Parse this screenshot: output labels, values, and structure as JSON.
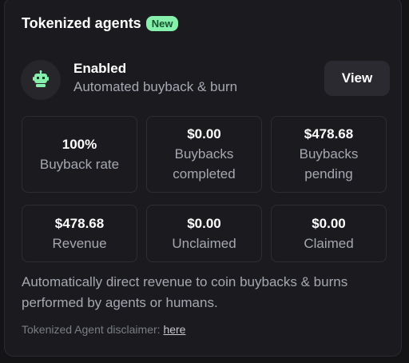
{
  "header": {
    "title": "Tokenized agents",
    "badge": "New"
  },
  "agent": {
    "icon": "robot-icon",
    "icon_color": "#86efac",
    "status": "Enabled",
    "description": "Automated buyback & burn",
    "view_label": "View"
  },
  "stats": [
    {
      "value": "100%",
      "label": "Buyback rate"
    },
    {
      "value": "$0.00",
      "label": "Buybacks completed"
    },
    {
      "value": "$478.68",
      "label": "Buybacks pending"
    },
    {
      "value": "$478.68",
      "label": "Revenue"
    },
    {
      "value": "$0.00",
      "label": "Unclaimed"
    },
    {
      "value": "$0.00",
      "label": "Claimed"
    }
  ],
  "description": "Automatically direct revenue to coin buybacks & burns performed by agents or humans.",
  "disclaimer": {
    "text": "Tokenized Agent disclaimer: ",
    "link_label": "here"
  },
  "colors": {
    "accent": "#86efac",
    "background": "#1b1b1f"
  }
}
